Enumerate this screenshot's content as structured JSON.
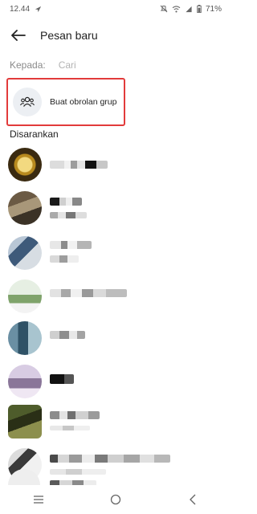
{
  "status_bar": {
    "time": "12.44",
    "battery": "71%",
    "icons": [
      "navigation-icon",
      "mute-icon",
      "wifi-icon",
      "signal-icon",
      "battery-icon"
    ]
  },
  "header": {
    "title": "Pesan baru",
    "back_icon": "arrow-left-icon"
  },
  "recipient": {
    "label": "Kepada:",
    "placeholder": "Cari"
  },
  "group_chat": {
    "label": "Buat obrolan grup",
    "icon": "people-icon",
    "highlight_color": "#e23b3b"
  },
  "suggested": {
    "title": "Disarankan",
    "contacts_note": "names and avatars pixelated in source",
    "count": 8
  },
  "nav_bar": {
    "buttons": [
      "menu-icon",
      "home-icon",
      "back-icon"
    ]
  }
}
